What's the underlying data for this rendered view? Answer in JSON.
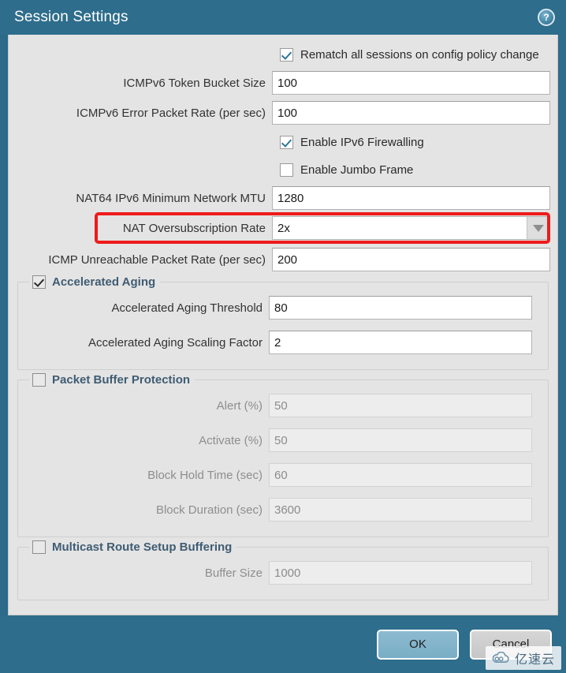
{
  "window": {
    "title": "Session Settings",
    "help_icon": "help-circle-icon",
    "help_glyph": "?"
  },
  "form": {
    "rematch": {
      "label": "Rematch all sessions on config policy change",
      "checked": true
    },
    "icmpv6_token_bucket": {
      "label": "ICMPv6 Token Bucket Size",
      "value": "100"
    },
    "icmpv6_error_rate": {
      "label": "ICMPv6 Error Packet Rate (per sec)",
      "value": "100"
    },
    "enable_ipv6_firewalling": {
      "label": "Enable IPv6 Firewalling",
      "checked": true
    },
    "enable_jumbo_frame": {
      "label": "Enable Jumbo Frame",
      "checked": false
    },
    "nat64_mtu": {
      "label": "NAT64 IPv6 Minimum Network MTU",
      "value": "1280"
    },
    "nat_oversubscription": {
      "label": "NAT Oversubscription Rate",
      "value": "2x",
      "highlight_color": "#ee1b1b",
      "arrow_icon": "chevron-down-icon"
    },
    "icmp_unreachable_rate": {
      "label": "ICMP Unreachable Packet Rate (per sec)",
      "value": "200"
    }
  },
  "accelerated_aging": {
    "legend": "Accelerated Aging",
    "checked": true,
    "fields": [
      {
        "label": "Accelerated Aging Threshold",
        "value": "80"
      },
      {
        "label": "Accelerated Aging Scaling Factor",
        "value": "2"
      }
    ]
  },
  "packet_buffer_protection": {
    "legend": "Packet Buffer Protection",
    "checked": false,
    "fields": [
      {
        "label": "Alert (%)",
        "value": "50"
      },
      {
        "label": "Activate (%)",
        "value": "50"
      },
      {
        "label": "Block Hold Time (sec)",
        "value": "60"
      },
      {
        "label": "Block Duration (sec)",
        "value": "3600"
      }
    ]
  },
  "multicast_route_setup_buffering": {
    "legend": "Multicast Route Setup Buffering",
    "checked": false,
    "fields": [
      {
        "label": "Buffer Size",
        "value": "1000"
      }
    ]
  },
  "footer": {
    "ok_label": "OK",
    "cancel_label": "Cancel"
  },
  "watermark": {
    "text": "亿速云",
    "logo_icon": "cloud-logo-icon"
  },
  "theme": {
    "chrome": "#2e6d8c",
    "panel_bg": "#e4e4e4",
    "accent": "#ee1b1b",
    "legend_text": "#3f5c73"
  }
}
